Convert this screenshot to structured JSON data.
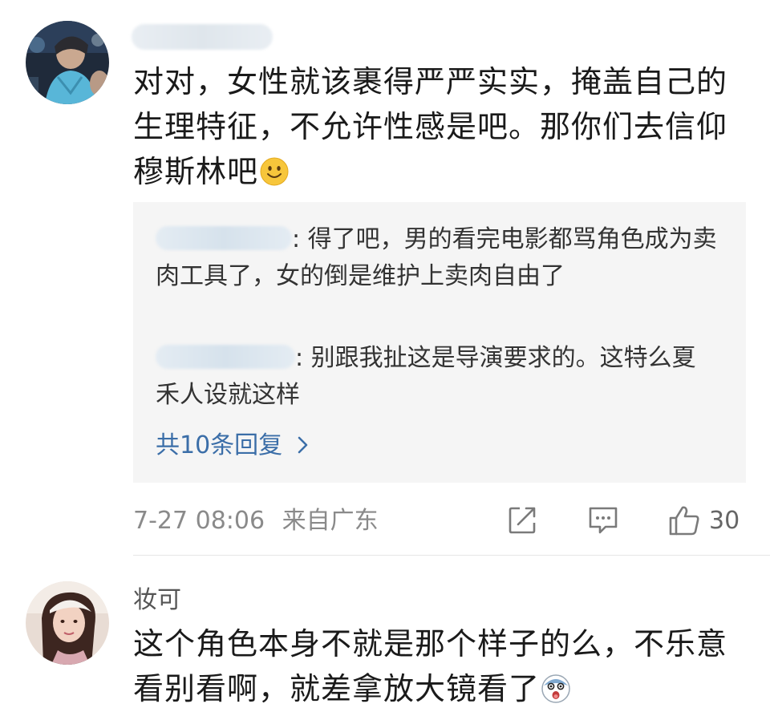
{
  "comments": [
    {
      "username": "",
      "text": "对对，女性就该裹得严严实实，掩盖自己的生理特征，不允许性感是吧。那你们去信仰穆斯林吧",
      "emoji": "smile-emoji",
      "replies": [
        {
          "author": "",
          "text": ": 得了吧，男的看完电影都骂角色成为卖肉工具了，女的倒是维护上卖肉自由了"
        },
        {
          "author": "",
          "text": ": 别跟我扯这是导演要求的。这特么夏禾人设就这样"
        }
      ],
      "reply_more": "共10条回复",
      "timestamp": "7-27 08:06",
      "location": "来自广东",
      "likes": "30"
    },
    {
      "username": "妆可",
      "text": "这个角色本身不就是那个样子的么，不乐意看别看啊，就差拿放大镜看了",
      "emoji": "shocked-face-emoji"
    }
  ],
  "icons": {
    "share": "share-icon",
    "comment": "comment-icon",
    "like": "thumbs-up-icon",
    "chevron": "chevron-right-icon"
  },
  "colors": {
    "link": "#3b6ea8",
    "meta": "#8a8a8a",
    "reply_bg": "#f5f5f5"
  }
}
